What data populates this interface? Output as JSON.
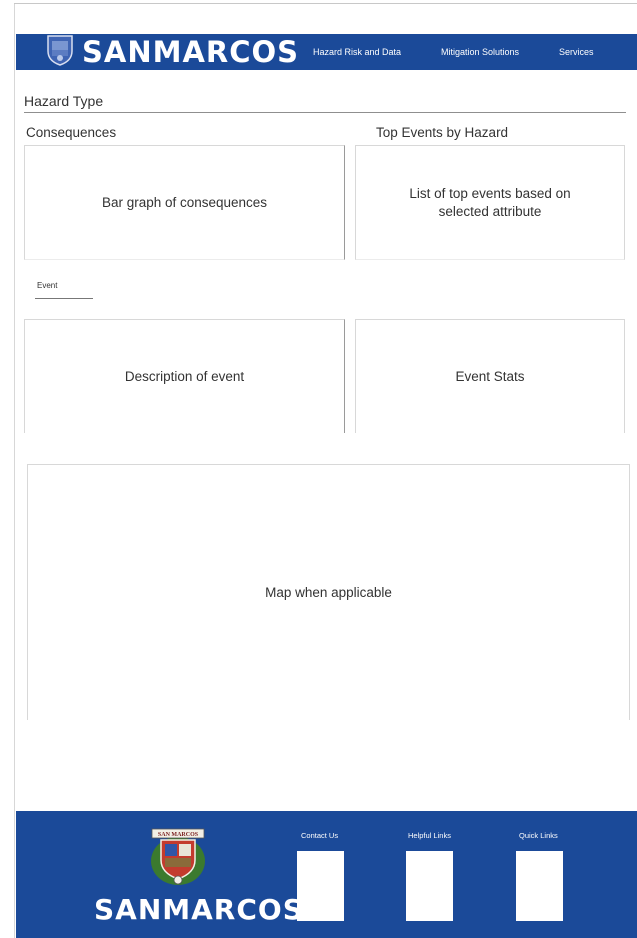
{
  "header": {
    "brand": "SANMARCOS",
    "nav": [
      "Hazard Risk and Data",
      "Mitigation Solutions",
      "Services"
    ]
  },
  "main": {
    "hazard_type_title": "Hazard Type",
    "consequences": {
      "title": "Consequences",
      "placeholder": "Bar graph of consequences"
    },
    "top_events": {
      "title": "Top Events by Hazard",
      "placeholder": "List of top events based on selected attribute"
    },
    "event_tab": "Event",
    "description_placeholder": "Description of event",
    "stats_placeholder": "Event Stats",
    "map_placeholder": "Map when applicable"
  },
  "footer": {
    "brand": "SANMARCOS",
    "seal_text": "SAN MARCOS",
    "columns": [
      "Contact Us",
      "Helpful Links",
      "Quick Links"
    ]
  },
  "colors": {
    "brand_blue": "#1b4a99",
    "white": "#ffffff"
  },
  "icons": [
    "city-seal-icon"
  ]
}
